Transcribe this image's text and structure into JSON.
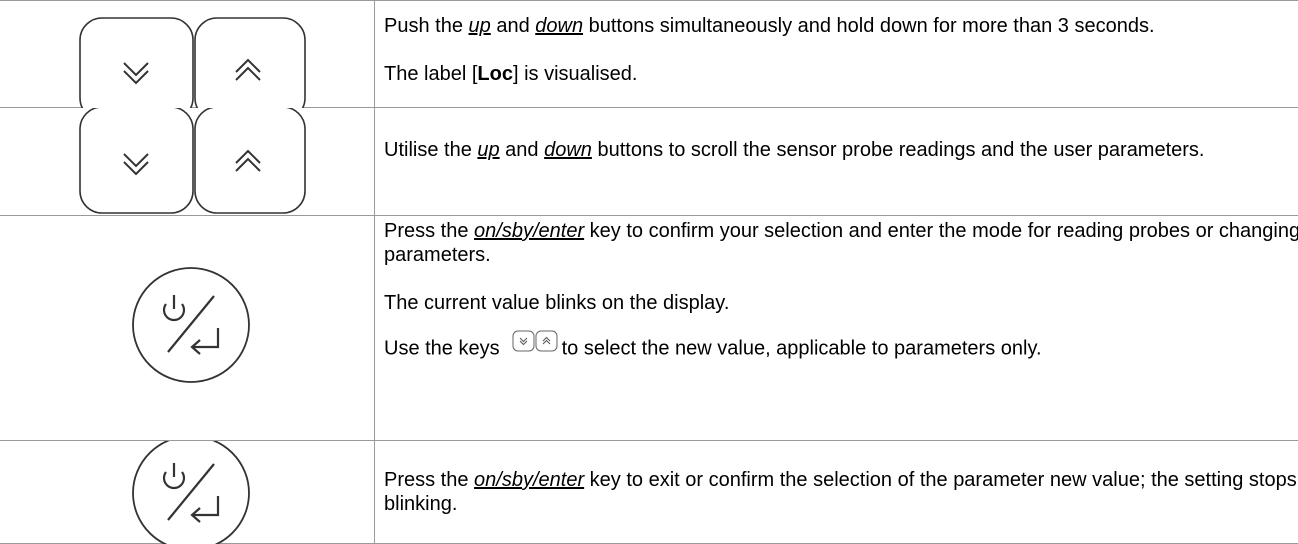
{
  "rows": [
    {
      "icon": "chevron-down-up-buttons",
      "text": {
        "line1_a": "Push the ",
        "up": "up",
        "line1_b": " and ",
        "down": "down",
        "line1_c": " buttons simultaneously and hold down for more than 3 seconds.",
        "line2_a": "The label [",
        "loc": "Loc",
        "line2_b": "] is visualised."
      }
    },
    {
      "icon": "chevron-down-up-buttons",
      "text": {
        "a": "Utilise the ",
        "up": "up",
        "b": " and ",
        "down": "down",
        "c": " buttons to scroll the sensor probe readings and the user parameters."
      }
    },
    {
      "icon": "power-enter-key",
      "text": {
        "a": "Press the ",
        "key": "on/sby/enter",
        "b": " key to confirm your selection and enter the mode for reading probes or changing parameters.",
        "p2": "The current value blinks on the display.",
        "p3_a": "Use the keys",
        "p3_b": "to select the new value, applicable to parameters only."
      }
    },
    {
      "icon": "power-enter-key",
      "text": {
        "a": "Press the ",
        "key": "on/sby/enter",
        "b": " key to exit or confirm the selection of the parameter new value; the setting stops blinking."
      }
    }
  ]
}
